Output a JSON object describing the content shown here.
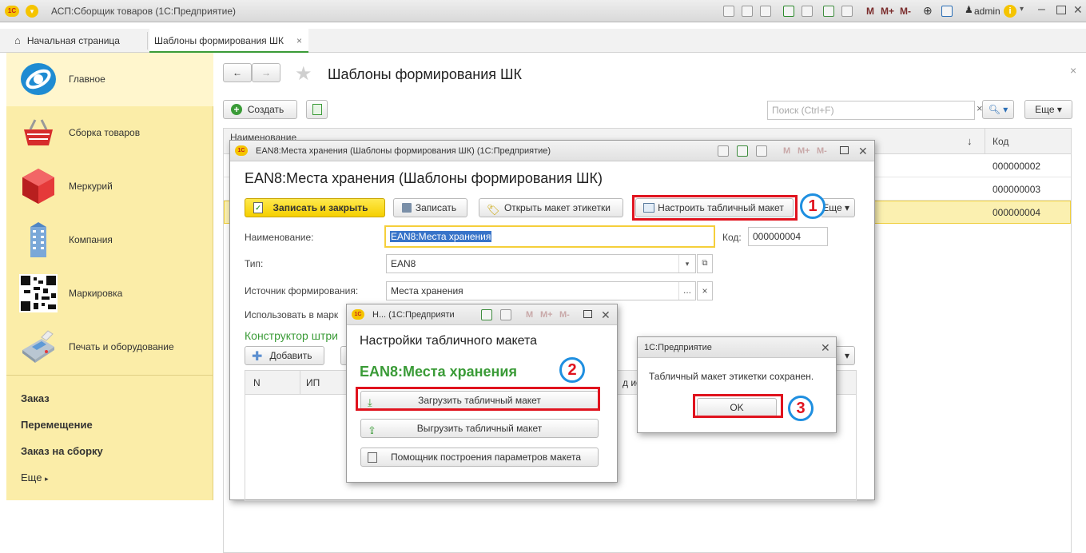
{
  "titlebar": {
    "title": "АСП:Сборщик товаров  (1С:Предприятие)",
    "user": "admin",
    "logo": "1С",
    "m1": "M",
    "m2": "M+",
    "m3": "M-"
  },
  "tabs": [
    {
      "label": "Начальная страница"
    },
    {
      "label": "Шаблоны формирования ШК"
    }
  ],
  "sidebar": {
    "items": [
      {
        "label": "Главное",
        "icon": "globe-icon"
      },
      {
        "label": "Сборка товаров",
        "icon": "basket-icon"
      },
      {
        "label": "Меркурий",
        "icon": "cube-icon"
      },
      {
        "label": "Компания",
        "icon": "building-icon"
      },
      {
        "label": "Маркировка",
        "icon": "barcode-icon"
      },
      {
        "label": "Печать и оборудование",
        "icon": "terminal-icon"
      }
    ],
    "links": [
      "Заказ",
      "Перемещение",
      "Заказ на сборку"
    ],
    "more": "Еще"
  },
  "main": {
    "title": "Шаблоны формирования ШК",
    "create": "Создать",
    "search_placeholder": "Поиск (Ctrl+F)",
    "more": "Еще",
    "col_name": "Наименование",
    "col_code": "Код",
    "sort": "↓",
    "codes": [
      "000000002",
      "000000003",
      "000000004"
    ]
  },
  "form": {
    "window_title": "EAN8:Места хранения (Шаблоны формирования ШК)  (1С:Предприятие)",
    "heading": "EAN8:Места хранения (Шаблоны формирования ШК)",
    "save_close": "Записать и закрыть",
    "save": "Записать",
    "open_label": "Открыть макет этикетки",
    "setup": "Настроить табличный макет",
    "more": "Еще",
    "name_label": "Наименование:",
    "name_value": "EAN8:Места хранения",
    "code_label": "Код:",
    "code_value": "000000004",
    "type_label": "Тип:",
    "type_value": "EAN8",
    "source_label": "Источник формирования:",
    "source_value": "Места хранения",
    "use_label": "Использовать в марк",
    "constructor": "Конструктор штри",
    "add": "Добавить",
    "col_n": "N",
    "col_ip": "ИП",
    "col_is": "д ис"
  },
  "dialog": {
    "window_title": "Н... (1С:Предприяти",
    "heading": "Настройки табличного макета",
    "subtitle": "EAN8:Места хранения",
    "load": "Загрузить табличный макет",
    "unload": "Выгрузить табличный макет",
    "helper": "Помощник построения параметров макета"
  },
  "message": {
    "window_title": "1С:Предприятие",
    "text": "Табличный макет этикетки сохранен.",
    "ok": "OK"
  },
  "callouts": [
    "1",
    "2",
    "3"
  ],
  "colors": {
    "accent_green": "#3a9b37",
    "sidebar": "#fbeda8",
    "highlight": "#e0131e",
    "selected_row": "#fbf0b0"
  }
}
